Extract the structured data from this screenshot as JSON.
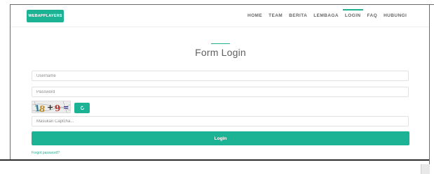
{
  "navbar": {
    "brand": "WEBAPPLAYERS",
    "items": [
      {
        "label": "HOME",
        "active": false
      },
      {
        "label": "TEAM",
        "active": false
      },
      {
        "label": "BERITA",
        "active": false
      },
      {
        "label": "LEMBAGA",
        "active": false
      },
      {
        "label": "LOGIN",
        "active": true
      },
      {
        "label": "FAQ",
        "active": false
      },
      {
        "label": "HUBUNGI",
        "active": false
      }
    ]
  },
  "form": {
    "title": "Form Login",
    "username": {
      "placeholder": "Username",
      "value": ""
    },
    "password": {
      "placeholder": "Password",
      "value": ""
    },
    "captcha": {
      "image_text": "18 + 9 =",
      "refresh_icon": "refresh-icon",
      "placeholder": "Masukan Captcha...",
      "value": ""
    },
    "login_label": "Login",
    "forgot_label": "Forgot password?"
  },
  "colors": {
    "accent": "#1bb394",
    "text": "#555555",
    "border": "#e1e1e1"
  }
}
